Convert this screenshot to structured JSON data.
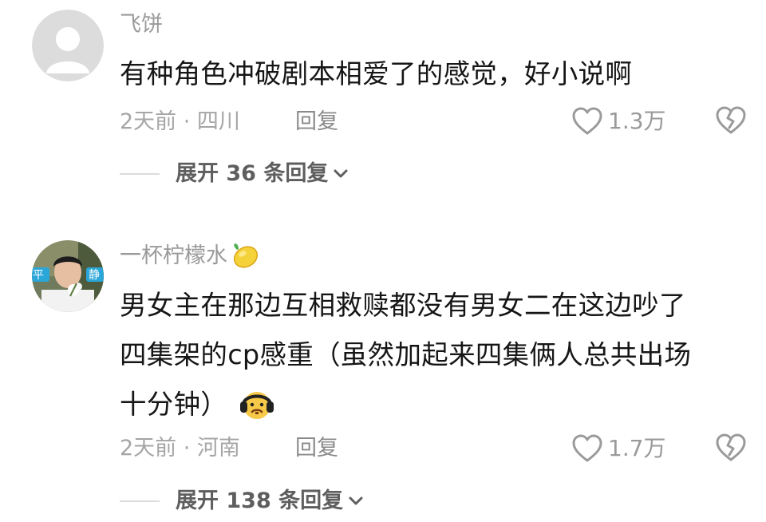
{
  "comments": [
    {
      "username": "飞饼",
      "avatar": "default-avatar-icon",
      "text_lines": [
        "有种角色冲破剧本相爱了的感觉，好小说啊"
      ],
      "meta": "2天前 · 四川",
      "reply_label": "回复",
      "likes": "1.3万",
      "expand_label": "展开 36 条回复"
    },
    {
      "username": "一杯柠檬水",
      "username_emoji": "lemon-icon",
      "avatar": "user-photo-avatar",
      "avatar_sign_left": "平",
      "avatar_sign_right": "静",
      "text_lines": [
        "男女主在那边互相救赎都没有男女二在这边吵了",
        "四集架的cp感重（虽然加起来四集俩人总共出场",
        "十分钟）"
      ],
      "text_emoji": "headphones-face-icon",
      "meta": "2天前 · 河南",
      "reply_label": "回复",
      "likes": "1.7万",
      "expand_label": "展开 138 条回复"
    }
  ],
  "colors": {
    "text": "#161616",
    "muted": "#9a9a9a",
    "expand": "#5e5e5e"
  }
}
